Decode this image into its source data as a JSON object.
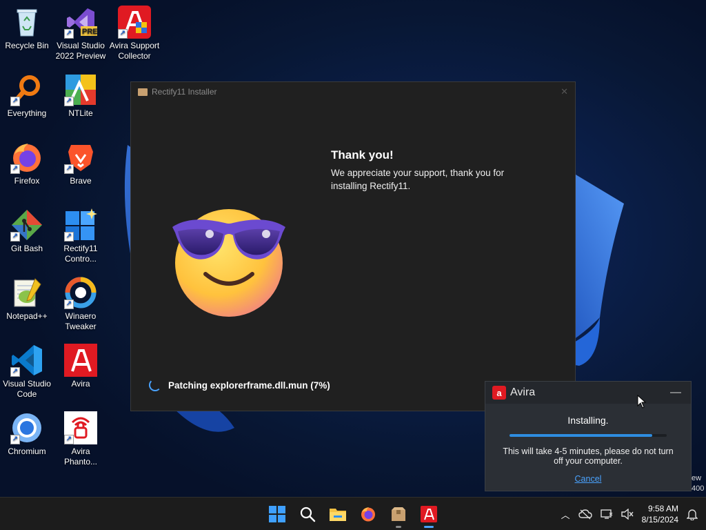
{
  "desktop": {
    "icons": [
      {
        "label": "Recycle Bin",
        "icon": "recycle-bin-icon"
      },
      {
        "label": "Visual Studio 2022 Preview",
        "icon": "visual-studio-preview-icon",
        "badge": "PRE"
      },
      {
        "label": "Avira Support Collector",
        "icon": "avira-support-icon"
      },
      {
        "label": "Everything",
        "icon": "everything-search-icon"
      },
      {
        "label": "NTLite",
        "icon": "ntlite-icon"
      },
      {
        "label": "Firefox",
        "icon": "firefox-icon"
      },
      {
        "label": "Brave",
        "icon": "brave-icon"
      },
      {
        "label": "Git Bash",
        "icon": "git-bash-icon"
      },
      {
        "label": "Rectify11 Contro...",
        "icon": "rectify11-control-icon"
      },
      {
        "label": "Notepad++",
        "icon": "notepad-plus-plus-icon"
      },
      {
        "label": "Winaero Tweaker",
        "icon": "winaero-tweaker-icon"
      },
      {
        "label": "Visual Studio Code",
        "icon": "vscode-icon"
      },
      {
        "label": "Avira",
        "icon": "avira-icon"
      },
      {
        "label": "Chromium",
        "icon": "chromium-icon"
      },
      {
        "label": "Avira Phanto...",
        "icon": "avira-phantom-icon"
      }
    ]
  },
  "installer": {
    "title": "Rectify11 Installer",
    "heading": "Thank you!",
    "message": "We appreciate your support, thank you for installing Rectify11.",
    "status": "Patching explorerframe.dll.mun (7%)"
  },
  "avira": {
    "name": "Avira",
    "status": "Installing.",
    "progress": 0.91,
    "message": "This will take 4-5 minutes, please do not turn off your computer.",
    "cancel": "Cancel"
  },
  "corner_text": {
    "line1": "ew",
    "line2": "400"
  },
  "taskbar": {
    "time": "9:58 AM",
    "date": "8/15/2024"
  }
}
